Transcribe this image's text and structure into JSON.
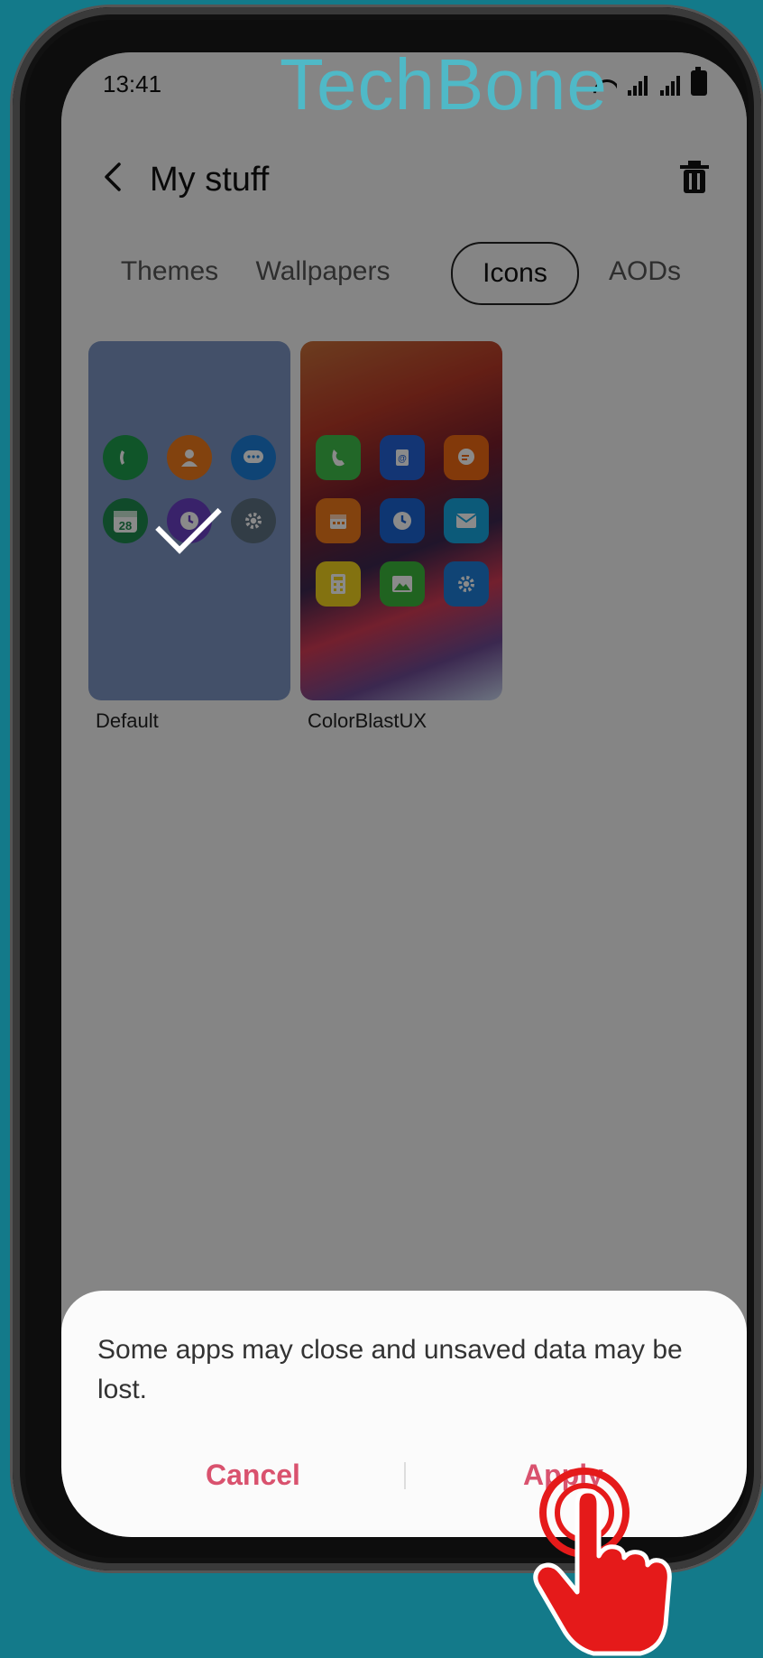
{
  "watermark": "TechBone",
  "status_bar": {
    "time": "13:41"
  },
  "header": {
    "title": "My stuff"
  },
  "tabs": [
    {
      "label": "Themes",
      "active": false
    },
    {
      "label": "Wallpapers",
      "active": false
    },
    {
      "label": "Icons",
      "active": true
    },
    {
      "label": "AODs",
      "active": false
    }
  ],
  "icon_packs": [
    {
      "label": "Default",
      "applied": true,
      "calendar_day": "28"
    },
    {
      "label": "ColorBlastUX",
      "applied": false
    }
  ],
  "dialog": {
    "message": "Some apps may close and unsaved data may be lost.",
    "cancel_label": "Cancel",
    "apply_label": "Apply"
  },
  "colors": {
    "accent": "#d9526e",
    "background": "#137a8a",
    "watermark": "#4fb9c7"
  },
  "icons": [
    "back-icon",
    "trash-icon",
    "wifi-icon",
    "signal-icon",
    "battery-icon",
    "check-icon",
    "tap-hand-icon"
  ]
}
